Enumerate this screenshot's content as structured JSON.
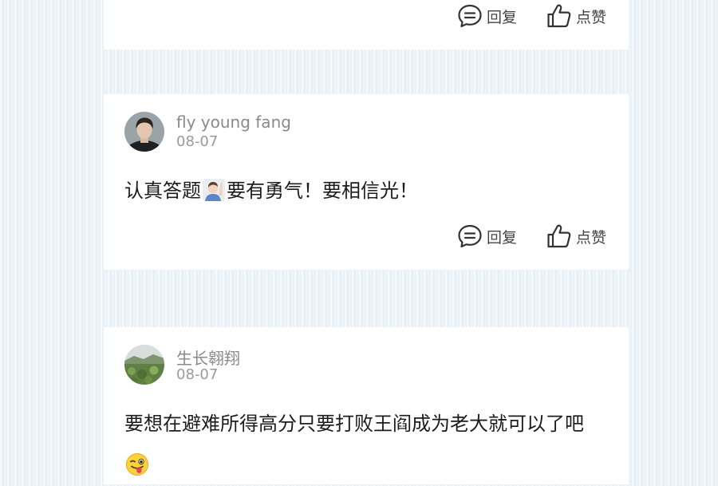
{
  "actions": {
    "reply_label": "回复",
    "like_label": "点赞"
  },
  "comments": [
    {
      "username": "fly young fang",
      "date": "08-07",
      "text_before_emoji": "认真答题",
      "emoji": "raising-hand-emoji",
      "text_after_emoji": "要有勇气！要相信光！"
    },
    {
      "username": "生长翱翔",
      "date": "08-07",
      "text": "要想在避难所得高分只要打败王阎成为老大就可以了吧",
      "emoji": "winking-tongue-emoji"
    }
  ],
  "colors": {
    "text": "#1c1c1c",
    "muted": "#8a8a8a",
    "background": "#e9f1f6",
    "card": "#ffffff"
  }
}
